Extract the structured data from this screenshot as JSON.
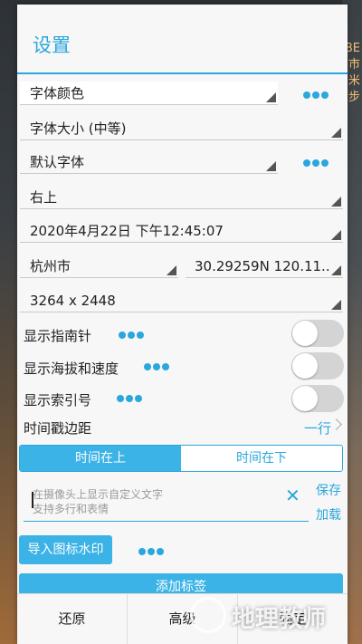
{
  "background": {
    "right_texts": [
      "BE",
      "市",
      "米",
      "步"
    ]
  },
  "dialog": {
    "title": "设置",
    "font_color": {
      "label": "字体颜色"
    },
    "font_size": {
      "label": "字体大小 (中等)"
    },
    "font_face": {
      "label": "默认字体"
    },
    "position": {
      "label": "右上"
    },
    "datetime": {
      "label": "2020年4月22日 下午12:45:07"
    },
    "city": {
      "label": "杭州市"
    },
    "coords": {
      "label": "30.29259N 120.11.."
    },
    "resolution": {
      "label": "3264 x 2448"
    },
    "toggles": [
      {
        "label": "显示指南针",
        "on": false
      },
      {
        "label": "显示海拔和速度",
        "on": false
      },
      {
        "label": "显示索引号",
        "on": false
      }
    ],
    "time_margin": {
      "label": "时间戳边距",
      "value": "一行"
    },
    "segments": {
      "top": "时间在上",
      "bottom": "时间在下",
      "selected": "top"
    },
    "custom_text": {
      "placeholder_line1": "在摄像头上显示自定义文字",
      "placeholder_line2": "支持多行和表情",
      "save": "保存",
      "load": "加载"
    },
    "import_logo": "导入图标水印",
    "add_tag": "添加标签",
    "buttons": {
      "reset": "还原",
      "advanced": "高级",
      "ok": "确定"
    }
  },
  "watermark": {
    "text": "地理教师"
  },
  "colors": {
    "accent": "#2aa7dc",
    "accent_fill": "#3cb3e6"
  }
}
